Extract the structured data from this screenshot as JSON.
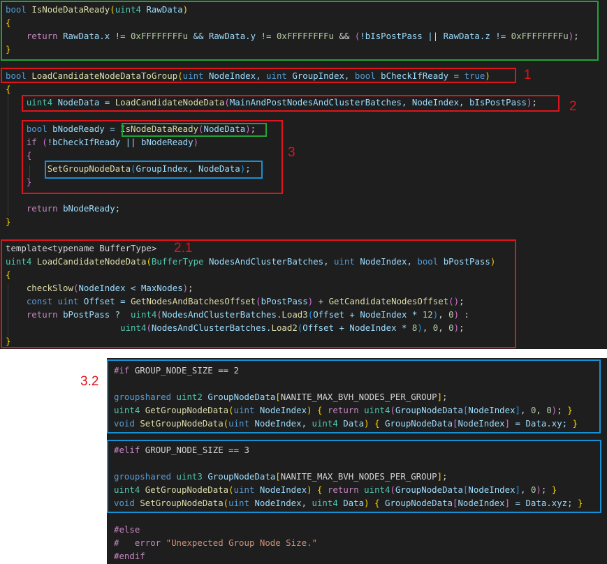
{
  "top_code": [
    [
      [
        "bool",
        "kw"
      ],
      [
        " ",
        "pl"
      ],
      [
        "IsNodeDataReady",
        "fn"
      ],
      [
        "(",
        "by"
      ],
      [
        "uint4",
        "ty"
      ],
      [
        " RawData",
        "va"
      ],
      [
        ")",
        "by"
      ]
    ],
    [
      [
        "{",
        "by"
      ]
    ],
    [
      [
        "    ",
        "pl"
      ],
      [
        "return",
        "pp"
      ],
      [
        " RawData.x != ",
        "va"
      ],
      [
        "0xFFFFFFFFu",
        "nu"
      ],
      [
        " && RawData.y != ",
        "va"
      ],
      [
        "0xFFFFFFFFu",
        "nu"
      ],
      [
        " && ",
        "pl"
      ],
      [
        "(",
        "bp"
      ],
      [
        "!bIsPostPass || RawData.z != ",
        "va"
      ],
      [
        "0xFFFFFFFFu",
        "nu"
      ],
      [
        ")",
        "bp"
      ],
      [
        ";",
        "pl"
      ]
    ],
    [
      [
        "}",
        "by"
      ]
    ],
    [
      [
        "",
        "pl"
      ]
    ],
    [
      [
        "bool",
        "kw"
      ],
      [
        " ",
        "pl"
      ],
      [
        "LoadCandidateNodeDataToGroup",
        "fn"
      ],
      [
        "(",
        "by"
      ],
      [
        "uint",
        "kw"
      ],
      [
        " NodeIndex, ",
        "va"
      ],
      [
        "uint",
        "kw"
      ],
      [
        " GroupIndex, ",
        "va"
      ],
      [
        "bool",
        "kw"
      ],
      [
        " bCheckIfReady = ",
        "va"
      ],
      [
        "true",
        "kw"
      ],
      [
        ")",
        "by"
      ]
    ],
    [
      [
        "{",
        "by"
      ]
    ],
    [
      [
        "    ",
        "pl"
      ],
      [
        "uint4",
        "ty"
      ],
      [
        " NodeData = ",
        "va"
      ],
      [
        "LoadCandidateNodeData",
        "fn"
      ],
      [
        "(",
        "bp"
      ],
      [
        "MainAndPostNodesAndClusterBatches, NodeIndex, bIsPostPass",
        "va"
      ],
      [
        ")",
        "bp"
      ],
      [
        ";",
        "pl"
      ]
    ],
    [
      [
        "",
        "pl"
      ]
    ],
    [
      [
        "    ",
        "pl"
      ],
      [
        "bool",
        "kw"
      ],
      [
        " bNodeReady = ",
        "va"
      ],
      [
        "IsNodeDataReady",
        "fn"
      ],
      [
        "(",
        "bp"
      ],
      [
        "NodeData",
        "va"
      ],
      [
        ")",
        "bp"
      ],
      [
        ";",
        "pl"
      ]
    ],
    [
      [
        "    ",
        "pl"
      ],
      [
        "if",
        "pp"
      ],
      [
        " ",
        "pl"
      ],
      [
        "(",
        "bp"
      ],
      [
        "!bCheckIfReady || bNodeReady",
        "va"
      ],
      [
        ")",
        "bp"
      ]
    ],
    [
      [
        "    ",
        "pl"
      ],
      [
        "{",
        "bp"
      ]
    ],
    [
      [
        "        ",
        "pl"
      ],
      [
        "SetGroupNodeData",
        "fn"
      ],
      [
        "(",
        "bb"
      ],
      [
        "GroupIndex, NodeData",
        "va"
      ],
      [
        ")",
        "bb"
      ],
      [
        ";",
        "pl"
      ]
    ],
    [
      [
        "    ",
        "pl"
      ],
      [
        "}",
        "bp"
      ]
    ],
    [
      [
        "",
        "pl"
      ]
    ],
    [
      [
        "    ",
        "pl"
      ],
      [
        "return",
        "pp"
      ],
      [
        " bNodeReady;",
        "va"
      ]
    ],
    [
      [
        "}",
        "by"
      ]
    ],
    [
      [
        "",
        "pl"
      ]
    ],
    [
      [
        "template<typename BufferType>",
        "pl"
      ]
    ],
    [
      [
        "uint4",
        "ty"
      ],
      [
        " ",
        "pl"
      ],
      [
        "LoadCandidateNodeData",
        "fn"
      ],
      [
        "(",
        "by"
      ],
      [
        "BufferType",
        "ty"
      ],
      [
        " NodesAndClusterBatches, ",
        "va"
      ],
      [
        "uint",
        "kw"
      ],
      [
        " NodeIndex, ",
        "va"
      ],
      [
        "bool",
        "kw"
      ],
      [
        " bPostPass",
        "va"
      ],
      [
        ")",
        "by"
      ]
    ],
    [
      [
        "{",
        "by"
      ]
    ],
    [
      [
        "    ",
        "pl"
      ],
      [
        "checkSlow",
        "fn"
      ],
      [
        "(",
        "bp"
      ],
      [
        "NodeIndex < MaxNodes",
        "va"
      ],
      [
        ")",
        "bp"
      ],
      [
        ";",
        "pl"
      ]
    ],
    [
      [
        "    ",
        "pl"
      ],
      [
        "const",
        "kw"
      ],
      [
        " ",
        "pl"
      ],
      [
        "uint",
        "kw"
      ],
      [
        " Offset = ",
        "va"
      ],
      [
        "GetNodesAndBatchesOffset",
        "fn"
      ],
      [
        "(",
        "bp"
      ],
      [
        "bPostPass",
        "va"
      ],
      [
        ")",
        "bp"
      ],
      [
        " + ",
        "pl"
      ],
      [
        "GetCandidateNodesOffset",
        "fn"
      ],
      [
        "(",
        "bp"
      ],
      [
        ")",
        "bp"
      ],
      [
        ";",
        "pl"
      ]
    ],
    [
      [
        "    ",
        "pl"
      ],
      [
        "return",
        "pp"
      ],
      [
        " bPostPass ? ",
        "va"
      ],
      [
        " uint4",
        "ty"
      ],
      [
        "(",
        "bp"
      ],
      [
        "NodesAndClusterBatches.",
        "va"
      ],
      [
        "Load3",
        "fn"
      ],
      [
        "(",
        "bb"
      ],
      [
        "Offset + NodeIndex * ",
        "va"
      ],
      [
        "12",
        "nu"
      ],
      [
        ")",
        "bb"
      ],
      [
        ", ",
        "pl"
      ],
      [
        "0",
        "nu"
      ],
      [
        ")",
        "bp"
      ],
      [
        " :",
        "pl"
      ]
    ],
    [
      [
        "                      ",
        "pl"
      ],
      [
        "uint4",
        "ty"
      ],
      [
        "(",
        "bp"
      ],
      [
        "NodesAndClusterBatches.",
        "va"
      ],
      [
        "Load2",
        "fn"
      ],
      [
        "(",
        "bb"
      ],
      [
        "Offset + NodeIndex * ",
        "va"
      ],
      [
        "8",
        "nu"
      ],
      [
        ")",
        "bb"
      ],
      [
        ", ",
        "pl"
      ],
      [
        "0",
        "nu"
      ],
      [
        ", ",
        "pl"
      ],
      [
        "0",
        "nu"
      ],
      [
        ")",
        "bp"
      ],
      [
        ";",
        "pl"
      ]
    ],
    [
      [
        "}",
        "by"
      ]
    ]
  ],
  "bottom_code": [
    [
      [
        "#if",
        "pp"
      ],
      [
        " GROUP_NODE_SIZE == 2",
        "pl"
      ]
    ],
    [
      [
        "",
        "pl"
      ]
    ],
    [
      [
        "groupshared",
        "kw"
      ],
      [
        " ",
        "pl"
      ],
      [
        "uint2",
        "ty"
      ],
      [
        " ",
        "pl"
      ],
      [
        "GroupNodeData",
        "va"
      ],
      [
        "[",
        "by"
      ],
      [
        "NANITE_MAX_BVH_NODES_PER_GROUP",
        "pl"
      ],
      [
        "]",
        "by"
      ],
      [
        ";",
        "pl"
      ]
    ],
    [
      [
        "uint4",
        "ty"
      ],
      [
        " ",
        "pl"
      ],
      [
        "GetGroupNodeData",
        "fn"
      ],
      [
        "(",
        "by"
      ],
      [
        "uint",
        "kw"
      ],
      [
        " NodeIndex",
        "va"
      ],
      [
        ")",
        "by"
      ],
      [
        " ",
        "pl"
      ],
      [
        "{",
        "by"
      ],
      [
        " ",
        "pl"
      ],
      [
        "return",
        "pp"
      ],
      [
        " ",
        "pl"
      ],
      [
        "uint4",
        "ty"
      ],
      [
        "(",
        "bp"
      ],
      [
        "GroupNodeData",
        "va"
      ],
      [
        "[",
        "bb"
      ],
      [
        "NodeIndex",
        "va"
      ],
      [
        "]",
        "bb"
      ],
      [
        ", ",
        "pl"
      ],
      [
        "0",
        "nu"
      ],
      [
        ", ",
        "pl"
      ],
      [
        "0",
        "nu"
      ],
      [
        ")",
        "bp"
      ],
      [
        "; ",
        "pl"
      ],
      [
        "}",
        "by"
      ]
    ],
    [
      [
        "void",
        "kw"
      ],
      [
        " ",
        "pl"
      ],
      [
        "SetGroupNodeData",
        "fn"
      ],
      [
        "(",
        "by"
      ],
      [
        "uint",
        "kw"
      ],
      [
        " NodeIndex, ",
        "va"
      ],
      [
        "uint4",
        "ty"
      ],
      [
        " Data",
        "va"
      ],
      [
        ")",
        "by"
      ],
      [
        " ",
        "pl"
      ],
      [
        "{",
        "by"
      ],
      [
        " GroupNodeData",
        "va"
      ],
      [
        "[",
        "bp"
      ],
      [
        "NodeIndex",
        "va"
      ],
      [
        "]",
        "bp"
      ],
      [
        " = Data.xy; ",
        "va"
      ],
      [
        "}",
        "by"
      ]
    ],
    [
      [
        "",
        "pl"
      ]
    ],
    [
      [
        "#elif",
        "pp"
      ],
      [
        " GROUP_NODE_SIZE == 3",
        "pl"
      ]
    ],
    [
      [
        "",
        "pl"
      ]
    ],
    [
      [
        "groupshared",
        "kw"
      ],
      [
        " ",
        "pl"
      ],
      [
        "uint3",
        "ty"
      ],
      [
        " ",
        "pl"
      ],
      [
        "GroupNodeData",
        "va"
      ],
      [
        "[",
        "by"
      ],
      [
        "NANITE_MAX_BVH_NODES_PER_GROUP",
        "pl"
      ],
      [
        "]",
        "by"
      ],
      [
        ";",
        "pl"
      ]
    ],
    [
      [
        "uint4",
        "ty"
      ],
      [
        " ",
        "pl"
      ],
      [
        "GetGroupNodeData",
        "fn"
      ],
      [
        "(",
        "by"
      ],
      [
        "uint",
        "kw"
      ],
      [
        " NodeIndex",
        "va"
      ],
      [
        ")",
        "by"
      ],
      [
        " ",
        "pl"
      ],
      [
        "{",
        "by"
      ],
      [
        " ",
        "pl"
      ],
      [
        "return",
        "pp"
      ],
      [
        " ",
        "pl"
      ],
      [
        "uint4",
        "ty"
      ],
      [
        "(",
        "bp"
      ],
      [
        "GroupNodeData",
        "va"
      ],
      [
        "[",
        "bb"
      ],
      [
        "NodeIndex",
        "va"
      ],
      [
        "]",
        "bb"
      ],
      [
        ", ",
        "pl"
      ],
      [
        "0",
        "nu"
      ],
      [
        ")",
        "bp"
      ],
      [
        "; ",
        "pl"
      ],
      [
        "}",
        "by"
      ]
    ],
    [
      [
        "void",
        "kw"
      ],
      [
        " ",
        "pl"
      ],
      [
        "SetGroupNodeData",
        "fn"
      ],
      [
        "(",
        "by"
      ],
      [
        "uint",
        "kw"
      ],
      [
        " NodeIndex, ",
        "va"
      ],
      [
        "uint4",
        "ty"
      ],
      [
        " Data",
        "va"
      ],
      [
        ")",
        "by"
      ],
      [
        " ",
        "pl"
      ],
      [
        "{",
        "by"
      ],
      [
        " GroupNodeData",
        "va"
      ],
      [
        "[",
        "bp"
      ],
      [
        "NodeIndex",
        "va"
      ],
      [
        "]",
        "bp"
      ],
      [
        " = Data.xyz; ",
        "va"
      ],
      [
        "}",
        "by"
      ]
    ],
    [
      [
        "",
        "pl"
      ]
    ],
    [
      [
        "#else",
        "pp"
      ]
    ],
    [
      [
        "#   ",
        "pp"
      ],
      [
        "error ",
        "pp"
      ],
      [
        "\"Unexpected Group Node Size.\"",
        "st"
      ]
    ],
    [
      [
        "#endif",
        "pp"
      ]
    ]
  ],
  "labels": {
    "label_1": "1",
    "label_2": "2",
    "label_3": "3",
    "label_2_1": "2.1",
    "label_3_2": "3.2"
  }
}
